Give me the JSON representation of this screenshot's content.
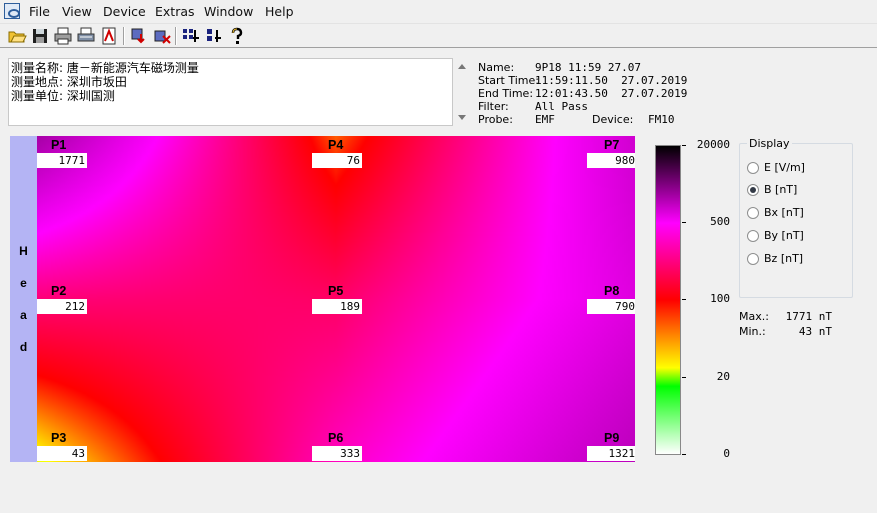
{
  "menu": [
    "File",
    "View",
    "Device",
    "Extras",
    "Window",
    "Help"
  ],
  "toolbar": [
    "open-icon",
    "save-icon",
    "print-icon",
    "print-preview-icon",
    "report-icon",
    "device-download-icon",
    "device-disconnect-icon",
    "settings-grid-icon",
    "settings-single-icon",
    "help-icon"
  ],
  "notes": [
    "测量名称: 唐－新能源汽车磁场测量",
    "测量地点: 深圳市坂田",
    "测量单位: 深圳国测"
  ],
  "info": {
    "name_label": "Name:",
    "name": "9P18 11:59 27.07",
    "start_label": "Start Time:",
    "start": "11:59:11.50  27.07.2019",
    "end_label": "End Time:",
    "end": "12:01:43.50  27.07.2019",
    "filter_label": "Filter:",
    "filter": "All Pass",
    "probe_label": "Probe:",
    "probe": "EMF",
    "device_label": "Device:",
    "device": "FM10"
  },
  "head_letters": [
    "H",
    "e",
    "a",
    "d"
  ],
  "points": [
    {
      "label": "P1",
      "value": "1771"
    },
    {
      "label": "P4",
      "value": "76"
    },
    {
      "label": "P7",
      "value": "980"
    },
    {
      "label": "P2",
      "value": "212"
    },
    {
      "label": "P5",
      "value": "189"
    },
    {
      "label": "P8",
      "value": "790"
    },
    {
      "label": "P3",
      "value": "43"
    },
    {
      "label": "P6",
      "value": "333"
    },
    {
      "label": "P9",
      "value": "1321"
    }
  ],
  "chart_data": {
    "type": "heatmap",
    "grid": [
      [
        1771,
        76,
        980
      ],
      [
        212,
        189,
        790
      ],
      [
        43,
        333,
        1321
      ]
    ],
    "color_scale_labels": [
      "20000",
      "500",
      "100",
      "20",
      "0"
    ],
    "colors": [
      "#000000",
      "#ff00ff",
      "#ff0000",
      "#ffff00",
      "#00ff00",
      "#ffffff"
    ]
  },
  "display": {
    "title": "Display",
    "options": [
      {
        "label": "E [V/m]",
        "selected": false
      },
      {
        "label": "B [nT]",
        "selected": true
      },
      {
        "label": "Bx [nT]",
        "selected": false
      },
      {
        "label": "By [nT]",
        "selected": false
      },
      {
        "label": "Bz [nT]",
        "selected": false
      }
    ]
  },
  "stats": {
    "max_label": "Max.:",
    "max": "1771 nT",
    "min_label": "Min.:",
    "min": "43 nT"
  }
}
